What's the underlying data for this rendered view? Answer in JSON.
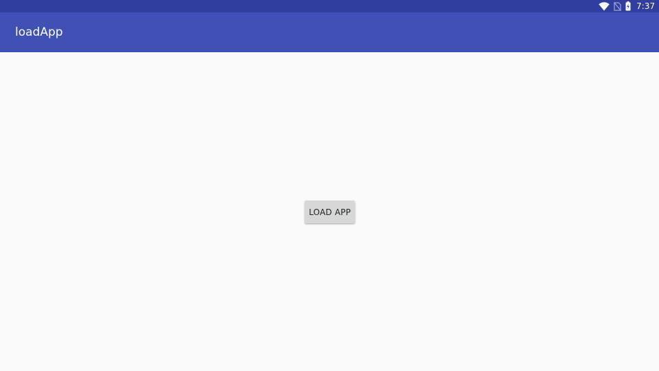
{
  "status_bar": {
    "time": "7:37",
    "icons": [
      "wifi-icon",
      "no-sim-icon",
      "battery-charging-icon"
    ],
    "background": "#303f9f"
  },
  "app_bar": {
    "title": "loadApp",
    "background": "#3f51b5"
  },
  "main": {
    "load_button_label": "LOAD APP",
    "background": "#fafafa",
    "button_background": "#d6d7d7"
  }
}
